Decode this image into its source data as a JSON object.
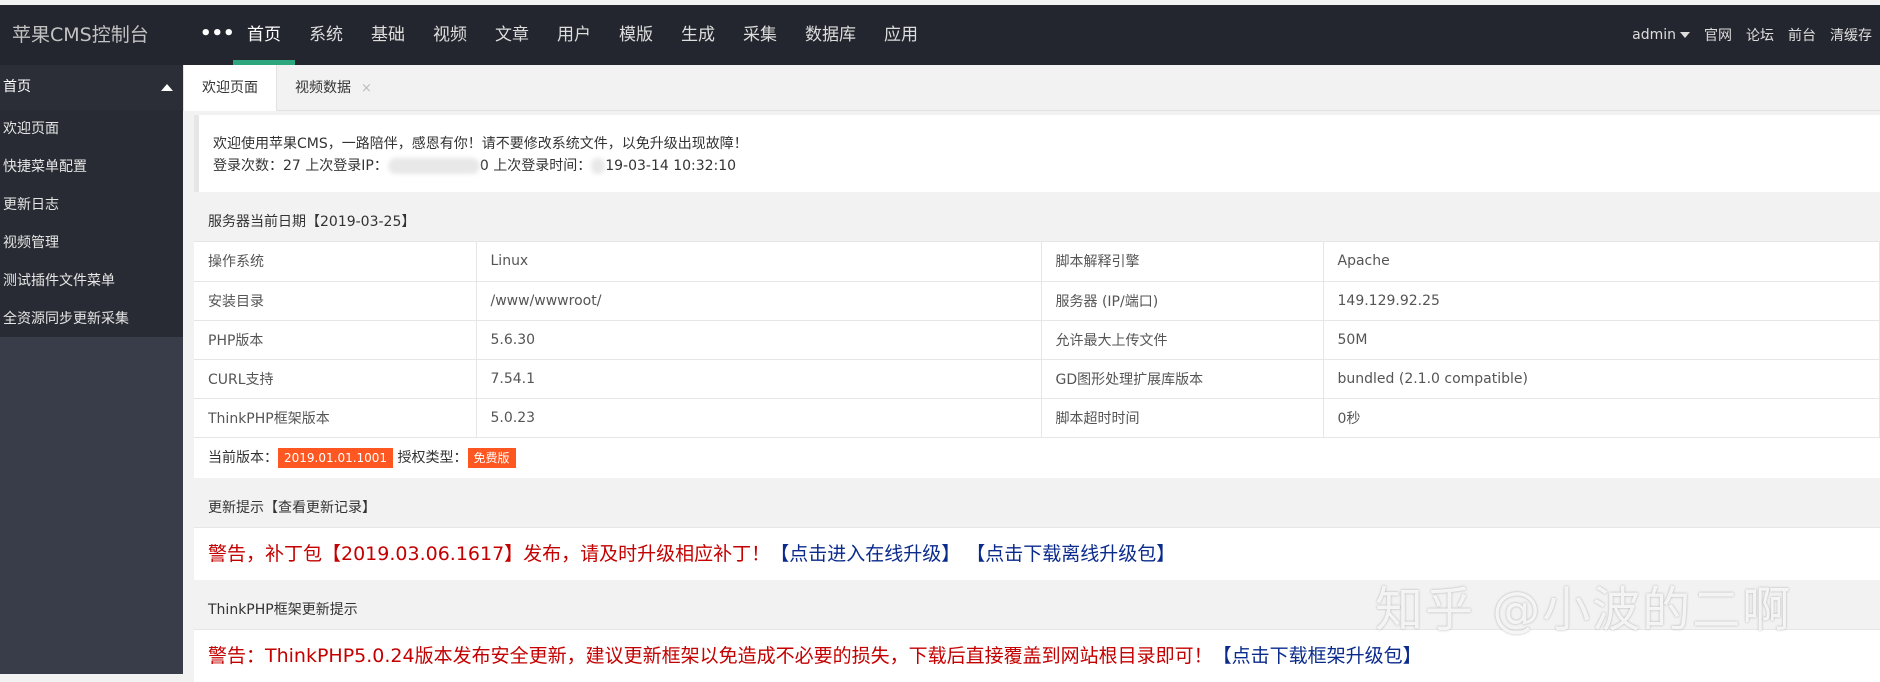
{
  "app": {
    "title": "苹果CMS控制台"
  },
  "nav": {
    "more": "•••",
    "items": [
      "首页",
      "系统",
      "基础",
      "视频",
      "文章",
      "用户",
      "模版",
      "生成",
      "采集",
      "数据库",
      "应用"
    ]
  },
  "topright": {
    "user": "admin",
    "links": [
      "官网",
      "论坛",
      "前台",
      "清缓存"
    ]
  },
  "sidebar": {
    "section": "首页",
    "items": [
      "欢迎页面",
      "快捷菜单配置",
      "更新日志",
      "视频管理",
      "测试插件文件菜单",
      "全资源同步更新采集"
    ]
  },
  "tabs": [
    {
      "label": "欢迎页面"
    },
    {
      "label": "视频数据",
      "close": "×"
    }
  ],
  "welcome": {
    "line1": "欢迎使用苹果CMS，一路陪伴，感恩有你！请不要修改系统文件，以免升级出现故障！",
    "login_count_label": "登录次数：27 上次登录IP：",
    "last_ip_tail": "0",
    "last_time_label": " 上次登录时间：",
    "last_time_value": "19-03-14 10:32:10"
  },
  "server": {
    "heading": "服务器当前日期【2019-03-25】",
    "rows": [
      [
        "操作系统",
        "Linux",
        "脚本解释引擎",
        "Apache"
      ],
      [
        "安装目录",
        "/www/wwwroot/",
        "服务器 (IP/端口)",
        "149.129.92.25"
      ],
      [
        "PHP版本",
        "5.6.30",
        "允许最大上传文件",
        "50M"
      ],
      [
        "CURL支持",
        "7.54.1",
        "GD图形处理扩展库版本",
        "bundled (2.1.0 compatible)"
      ],
      [
        "ThinkPHP框架版本",
        "5.0.23",
        "脚本超时时间",
        "0秒"
      ]
    ],
    "version_label": "当前版本：",
    "version_value": "2019.01.01.1001",
    "license_label": "授权类型：",
    "license_value": "免费版"
  },
  "update": {
    "heading": "更新提示【查看更新记录】",
    "warn_text": "警告，补丁包【2019.03.06.1617】发布，请及时升级相应补丁！",
    "link1": "【点击进入在线升级】",
    "link2": "【点击下载离线升级包】"
  },
  "framework": {
    "heading": "ThinkPHP框架更新提示",
    "warn_text": "警告：ThinkPHP5.0.24版本发布安全更新，建议更新框架以免造成不必要的损失，下载后直接覆盖到网站根目录即可！",
    "link": "【点击下载框架升级包】"
  },
  "watermark": "知乎 @小波的二啊",
  "colors": {
    "topbar": "#23262e",
    "sidebar": "#393d49",
    "accent": "#2da67d",
    "badge": "#ff5722",
    "warn": "#c40000",
    "link": "#0a2a8c"
  }
}
